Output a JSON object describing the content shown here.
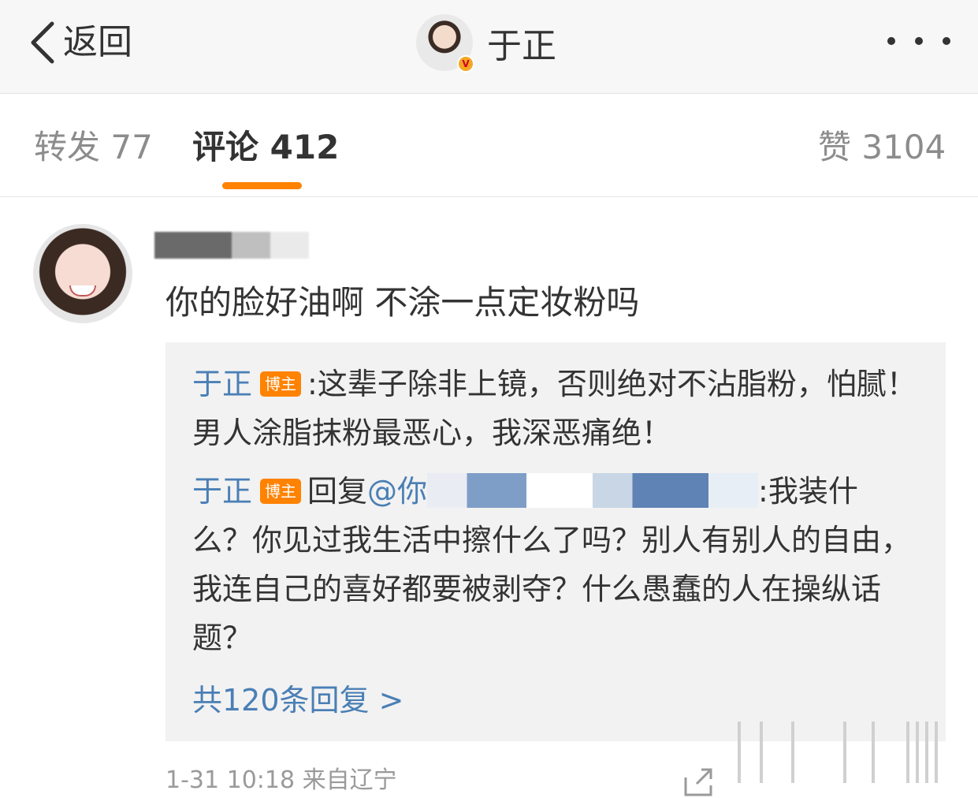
{
  "nav": {
    "back_label": "返回",
    "title": "于正",
    "verified_badge": "V",
    "more_icon": "more-dots-icon",
    "back_icon": "chevron-left-icon"
  },
  "tabs": {
    "forward": "转发 77",
    "comment": "评论 412",
    "like": "赞 3104",
    "active_color": "#ff8200"
  },
  "comment": {
    "username": "",
    "text": "你的脸好油啊 不涂一点定妆粉吗"
  },
  "replies": {
    "items": [
      {
        "author": "于正",
        "badge": "博主",
        "text": ":这辈子除非上镜，否则绝对不沾脂粉，怕腻！男人涂脂抹粉最恶心，我深恶痛绝！"
      },
      {
        "author": "于正",
        "badge": "博主",
        "reply_prefix": "回复",
        "mention": "@你",
        "text": ":我装什么？你见过我生活中擦什么了吗？别人有别人的自由，我连自己的喜好都要被剥夺？什么愚蠢的人在操纵话题？"
      }
    ],
    "more": "共120条回复 >"
  },
  "footer": {
    "meta": "1-31 10:18 来自辽宁",
    "share_icon": "share-icon"
  },
  "colors": {
    "link": "#4a7fb5",
    "badge": "#ff8200",
    "reply_bg": "#f2f2f2"
  }
}
